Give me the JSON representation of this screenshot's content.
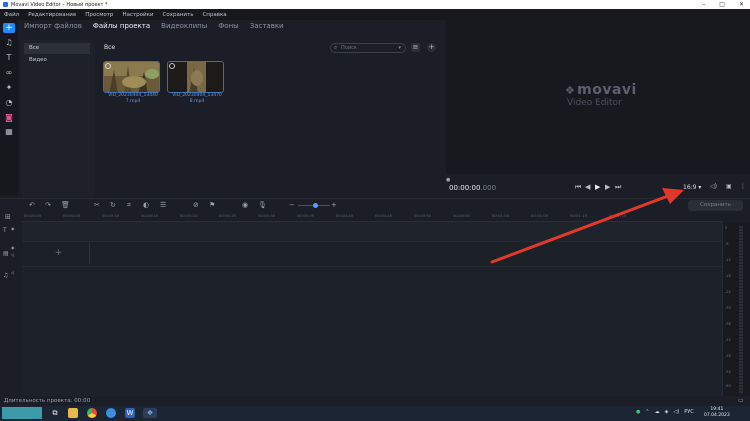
{
  "window": {
    "title": "Movavi Video Editor – Новый проект *"
  },
  "menu": [
    "Файл",
    "Редактирование",
    "Просмотр",
    "Настройки",
    "Сохранить",
    "Справка"
  ],
  "toolstrip": [
    "add-icon",
    "music-note-icon",
    "text-icon",
    "transitions-icon",
    "filter-magic-icon",
    "stickers-icon",
    "callouts-icon",
    "more-tools-icon"
  ],
  "tabs": [
    "Импорт файлов",
    "Файлы проекта",
    "Видеоклипы",
    "Фоны",
    "Заставки"
  ],
  "active_tab": "Файлы проекта",
  "categories": [
    "Все",
    "Видео"
  ],
  "filter_label": "Все",
  "search": {
    "placeholder": "Поиск"
  },
  "files": [
    {
      "name": "VID_20230404_13440",
      "ext": "7.mp4"
    },
    {
      "name": "VID_20230404_13470",
      "ext": "8.mp4"
    }
  ],
  "preview": {
    "logo": "movavi",
    "logo_sub": "Video Editor",
    "time": "00:00:00",
    "time_frac": ".000",
    "aspect": "16:9 ▾"
  },
  "timeline": {
    "save_label": "Сохранить",
    "ruler": [
      "00:00:00",
      "00:00:05",
      "00:00:10",
      "00:00:15",
      "00:00:20",
      "00:00:25",
      "00:00:30",
      "00:00:35",
      "00:00:40",
      "00:00:45",
      "00:00:50",
      "00:00:55",
      "00:01:00",
      "00:01:05",
      "00:01:10",
      "00:01:15"
    ],
    "add_track": "+"
  },
  "meter_labels": [
    "0",
    "-6",
    "-12",
    "-18",
    "-24",
    "-30",
    "-36",
    "-42",
    "-48",
    "-54",
    "-60"
  ],
  "status": "Длительность проекта: 00:00",
  "taskbar": {
    "lang": "РУС",
    "time": "19:41",
    "date": "07.04.2023"
  },
  "colors": {
    "accent": "#1e8bff",
    "arrow": "#e0392b",
    "file_name": "#5b9cff"
  }
}
